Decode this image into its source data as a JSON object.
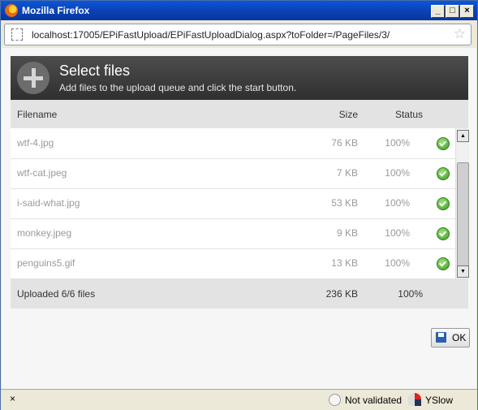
{
  "window": {
    "title": "Mozilla Firefox",
    "controls": [
      "_",
      "□",
      "×"
    ]
  },
  "address": {
    "url": "localhost:17005/EPiFastUpload/EPiFastUploadDialog.aspx?toFolder=/PageFiles/3/"
  },
  "header": {
    "title": "Select files",
    "subtitle": "Add files to the upload queue and click the start button."
  },
  "table": {
    "columns": {
      "filename": "Filename",
      "size": "Size",
      "status": "Status"
    },
    "rows": [
      {
        "name": "wtf-4.jpg",
        "size": "76 KB",
        "status": "100%"
      },
      {
        "name": "wtf-cat.jpeg",
        "size": "7 KB",
        "status": "100%"
      },
      {
        "name": "i-said-what.jpg",
        "size": "53 KB",
        "status": "100%"
      },
      {
        "name": "monkey.jpeg",
        "size": "9 KB",
        "status": "100%"
      },
      {
        "name": "penguins5.gif",
        "size": "13 KB",
        "status": "100%"
      }
    ],
    "total": {
      "label": "Uploaded 6/6 files",
      "size": "236 KB",
      "status": "100%"
    }
  },
  "ok_button": {
    "label": "OK"
  },
  "statusbar": {
    "close": "×",
    "validation": "Not validated",
    "yslow": "YSlow"
  },
  "colors": {
    "header_bg": "#3a3a3a",
    "titlebar": "#0b44b9",
    "check": "#3b9a22"
  }
}
